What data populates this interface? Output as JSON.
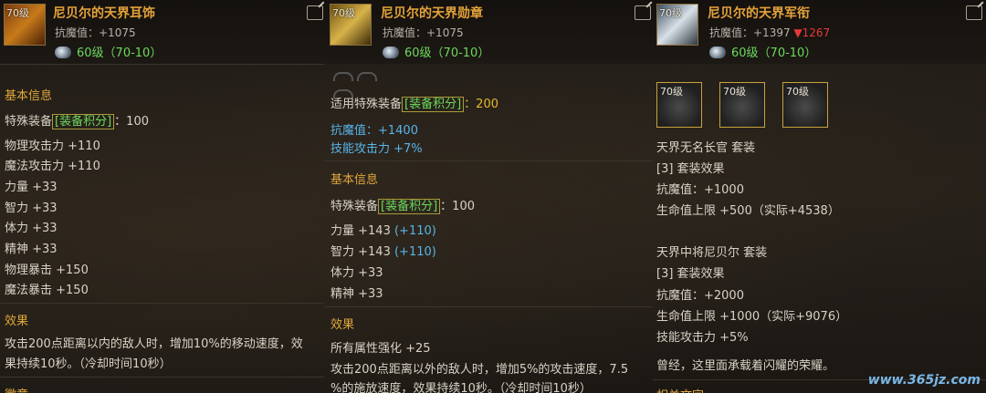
{
  "p1": {
    "icon_level": "70级",
    "name": "尼贝尔的天界耳饰",
    "resist": "抗魔值：+1075",
    "level_range": "60级（70-10）",
    "basic_title": "基本信息",
    "special_prefix": "特殊装备",
    "special_tag": "[装备积分]",
    "special_val": "：100",
    "stats": [
      "物理攻击力 +110",
      "魔法攻击力 +110",
      "力量 +33",
      "智力 +33",
      "体力 +33",
      "精神 +33",
      "物理暴击 +150",
      "魔法暴击 +150"
    ],
    "effect_title": "效果",
    "effect_l1": "攻击200点距离以内的敌人时，增加10%的移动速度，效",
    "effect_l2": "果持续10秒。（冷却时间10秒）",
    "bottom_title": "徽章"
  },
  "p2": {
    "icon_level": "70级",
    "name": "尼贝尔的天界勋章",
    "resist": "抗魔值：+1075",
    "level_range": "60级（70-10）",
    "applicable_prefix": "适用特殊装备",
    "applicable_tag": "[装备积分]",
    "applicable_val": "：200",
    "bonus1": "抗魔值：+1400",
    "bonus2": "技能攻击力 +7%",
    "basic_title": "基本信息",
    "special_prefix": "特殊装备",
    "special_tag": "[装备积分]",
    "special_val": "：100",
    "str": "力量 +143 ",
    "str_add": "(+110)",
    "int": "智力 +143 ",
    "int_add": "(+110)",
    "vit": "体力 +33",
    "spi": "精神 +33",
    "effect_title": "效果",
    "effect_all": "所有属性强化 +25",
    "effect_l1": "攻击200点距离以外的敌人时，增加5%的攻击速度，7.5",
    "effect_l2": "%的施放速度，效果持续10秒。（冷却时间10秒）"
  },
  "p3": {
    "icon_level": "70级",
    "name": "尼贝尔的天界军衔",
    "resist_prefix": "抗魔值：+1397 ",
    "resist_delta": "▼1267",
    "level_range": "60级（70-10）",
    "set_icons": [
      "70级",
      "70级",
      "70级"
    ],
    "set1_name": "天界无名长官  套装",
    "set1_effect": "[3] 套装效果",
    "set1_resist": "抗魔值：+1000",
    "set1_hp": "生命值上限 +500（实际+4538）",
    "set2_name": "天界中将尼贝尔  套装",
    "set2_effect": "[3] 套装效果",
    "set2_resist": "抗魔值：+2000",
    "set2_hp": "生命值上限 +1000（实际+9076）",
    "set2_skill": "技能攻击力 +5%",
    "flavor": "曾经，这里面承载着闪耀的荣耀。",
    "bottom_title": "相关文字"
  },
  "watermark": "www.365jz.com",
  "colors": {
    "title": "#e4a23a",
    "green": "#6cd85c",
    "blue": "#58b4e8",
    "gold": "#e8b830",
    "red": "#e83a3a"
  }
}
